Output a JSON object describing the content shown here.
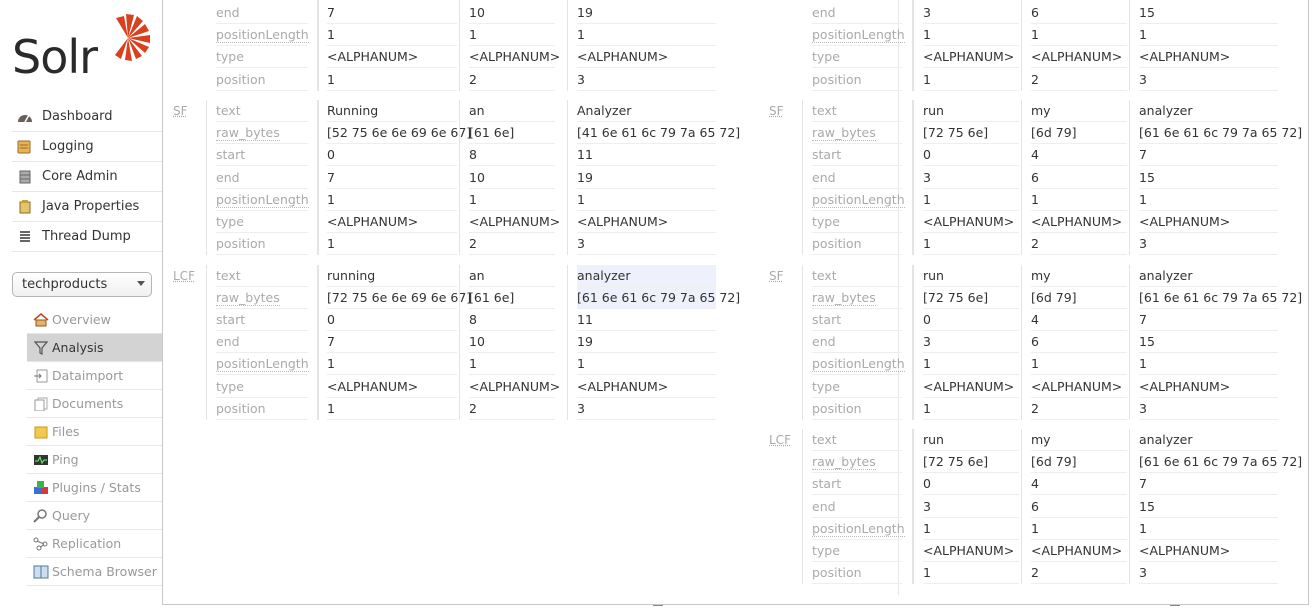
{
  "app": {
    "logo_text": "Solr",
    "accent": "#d9411e"
  },
  "nav": [
    {
      "label": "Dashboard",
      "icon": "dashboard-icon"
    },
    {
      "label": "Logging",
      "icon": "logging-icon"
    },
    {
      "label": "Core Admin",
      "icon": "core-admin-icon"
    },
    {
      "label": "Java Properties",
      "icon": "java-properties-icon"
    },
    {
      "label": "Thread Dump",
      "icon": "thread-dump-icon"
    }
  ],
  "core_selector": {
    "value": "techproducts"
  },
  "core_nav": [
    {
      "label": "Overview",
      "icon": "overview-icon",
      "active": false
    },
    {
      "label": "Analysis",
      "icon": "analysis-icon",
      "active": true
    },
    {
      "label": "Dataimport",
      "icon": "dataimport-icon",
      "active": false
    },
    {
      "label": "Documents",
      "icon": "documents-icon",
      "active": false
    },
    {
      "label": "Files",
      "icon": "files-icon",
      "active": false
    },
    {
      "label": "Ping",
      "icon": "ping-icon",
      "active": false
    },
    {
      "label": "Plugins / Stats",
      "icon": "plugins-icon",
      "active": false
    },
    {
      "label": "Query",
      "icon": "query-icon",
      "active": false
    },
    {
      "label": "Replication",
      "icon": "replication-icon",
      "active": false
    },
    {
      "label": "Schema Browser",
      "icon": "schema-browser-icon",
      "active": false
    }
  ],
  "attr_labels": [
    "text",
    "raw_bytes",
    "start",
    "end",
    "positionLength",
    "type",
    "position"
  ],
  "left_panel": {
    "partial_top": {
      "labels": [
        "end",
        "positionLength",
        "type",
        "position"
      ],
      "tokens": [
        [
          "7",
          "1",
          "<ALPHANUM>",
          "1"
        ],
        [
          "10",
          "1",
          "<ALPHANUM>",
          "2"
        ],
        [
          "19",
          "1",
          "<ALPHANUM>",
          "3"
        ]
      ]
    },
    "stages": [
      {
        "abbr": "SF",
        "tokens": [
          [
            "Running",
            "[52 75 6e 6e 69 6e 67]",
            "0",
            "7",
            "1",
            "<ALPHANUM>",
            "1"
          ],
          [
            "an",
            "[61 6e]",
            "8",
            "10",
            "1",
            "<ALPHANUM>",
            "2"
          ],
          [
            "Analyzer",
            "[41 6e 61 6c 79 7a 65 72]",
            "11",
            "19",
            "1",
            "<ALPHANUM>",
            "3"
          ]
        ]
      },
      {
        "abbr": "LCF",
        "tokens": [
          [
            "running",
            "[72 75 6e 6e 69 6e 67]",
            "0",
            "7",
            "1",
            "<ALPHANUM>",
            "1"
          ],
          [
            "an",
            "[61 6e]",
            "8",
            "10",
            "1",
            "<ALPHANUM>",
            "2"
          ],
          [
            "analyzer",
            "[61 6e 61 6c 79 7a 65 72]",
            "11",
            "19",
            "1",
            "<ALPHANUM>",
            "3"
          ]
        ]
      }
    ]
  },
  "right_panel": {
    "partial_top": {
      "labels": [
        "end",
        "positionLength",
        "type",
        "position"
      ],
      "tokens": [
        [
          "3",
          "1",
          "<ALPHANUM>",
          "1"
        ],
        [
          "6",
          "1",
          "<ALPHANUM>",
          "2"
        ],
        [
          "15",
          "1",
          "<ALPHANUM>",
          "3"
        ]
      ]
    },
    "stages": [
      {
        "abbr": "SF",
        "tokens": [
          [
            "run",
            "[72 75 6e]",
            "0",
            "3",
            "1",
            "<ALPHANUM>",
            "1"
          ],
          [
            "my",
            "[6d 79]",
            "4",
            "6",
            "1",
            "<ALPHANUM>",
            "2"
          ],
          [
            "analyzer",
            "[61 6e 61 6c 79 7a 65 72]",
            "7",
            "15",
            "1",
            "<ALPHANUM>",
            "3"
          ]
        ]
      },
      {
        "abbr": "SF",
        "tokens": [
          [
            "run",
            "[72 75 6e]",
            "0",
            "3",
            "1",
            "<ALPHANUM>",
            "1"
          ],
          [
            "my",
            "[6d 79]",
            "4",
            "6",
            "1",
            "<ALPHANUM>",
            "2"
          ],
          [
            "analyzer",
            "[61 6e 61 6c 79 7a 65 72]",
            "7",
            "15",
            "1",
            "<ALPHANUM>",
            "3"
          ]
        ]
      },
      {
        "abbr": "LCF",
        "tokens": [
          [
            "run",
            "[72 75 6e]",
            "0",
            "3",
            "1",
            "<ALPHANUM>",
            "1"
          ],
          [
            "my",
            "[6d 79]",
            "4",
            "6",
            "1",
            "<ALPHANUM>",
            "2"
          ],
          [
            "analyzer",
            "[61 6e 61 6c 79 7a 65 72]",
            "7",
            "15",
            "1",
            "<ALPHANUM>",
            "3"
          ]
        ]
      }
    ]
  }
}
